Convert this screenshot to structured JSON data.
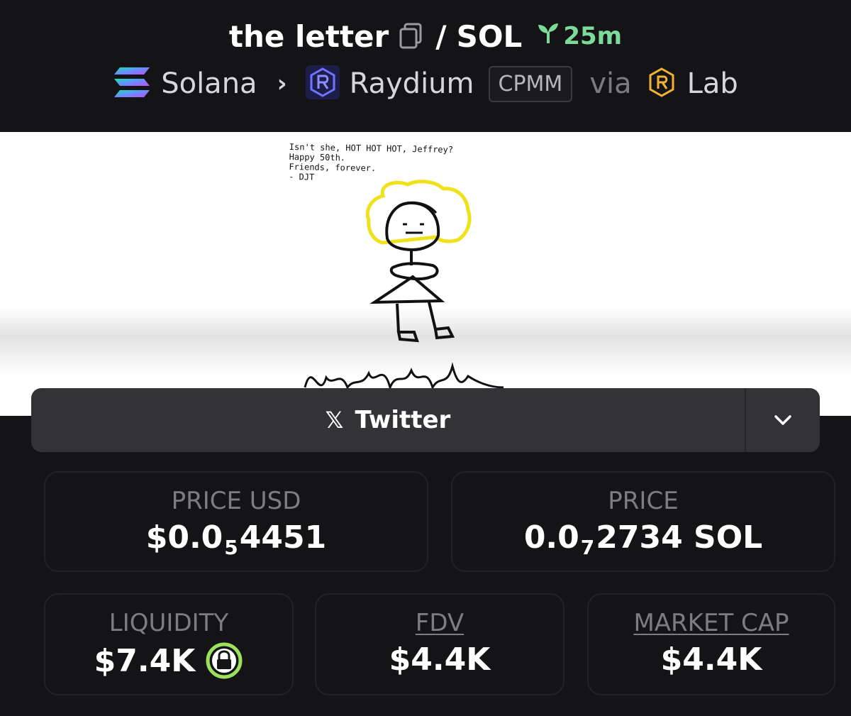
{
  "header": {
    "pair_base": "the letter",
    "separator": "/",
    "pair_quote": "SOL",
    "age": "25m",
    "chain": "Solana",
    "dex": "Raydium",
    "pool_type": "CPMM",
    "via": "via",
    "launchpad": "Lab"
  },
  "banner": {
    "note_lines": [
      "Isn't she, HOT HOT HOT, Jeffrey?",
      "Happy 50th.",
      "Friends, forever.",
      "- DJT"
    ]
  },
  "social": {
    "label": "Twitter",
    "x_glyph": "𝕏"
  },
  "stats": {
    "price_usd": {
      "label": "PRICE USD",
      "prefix": "$0.0",
      "zeros": "5",
      "digits": "4451"
    },
    "price": {
      "label": "PRICE",
      "prefix": "0.0",
      "zeros": "7",
      "digits": "2734 SOL"
    },
    "liquidity": {
      "label": "LIQUIDITY",
      "value": "$7.4K"
    },
    "fdv": {
      "label": "FDV",
      "value": "$4.4K"
    },
    "market_cap": {
      "label": "MARKET CAP",
      "value": "$4.4K"
    }
  },
  "colors": {
    "age_green": "#7ddb9a",
    "lock_green": "#9be15d",
    "background": "#141417"
  },
  "icons": [
    "copy-icon",
    "seedling-icon",
    "solana-logo-icon",
    "chevron-right-icon",
    "raydium-logo-icon",
    "launchpad-logo-icon",
    "x-logo-icon",
    "chevron-down-icon",
    "lock-icon"
  ]
}
